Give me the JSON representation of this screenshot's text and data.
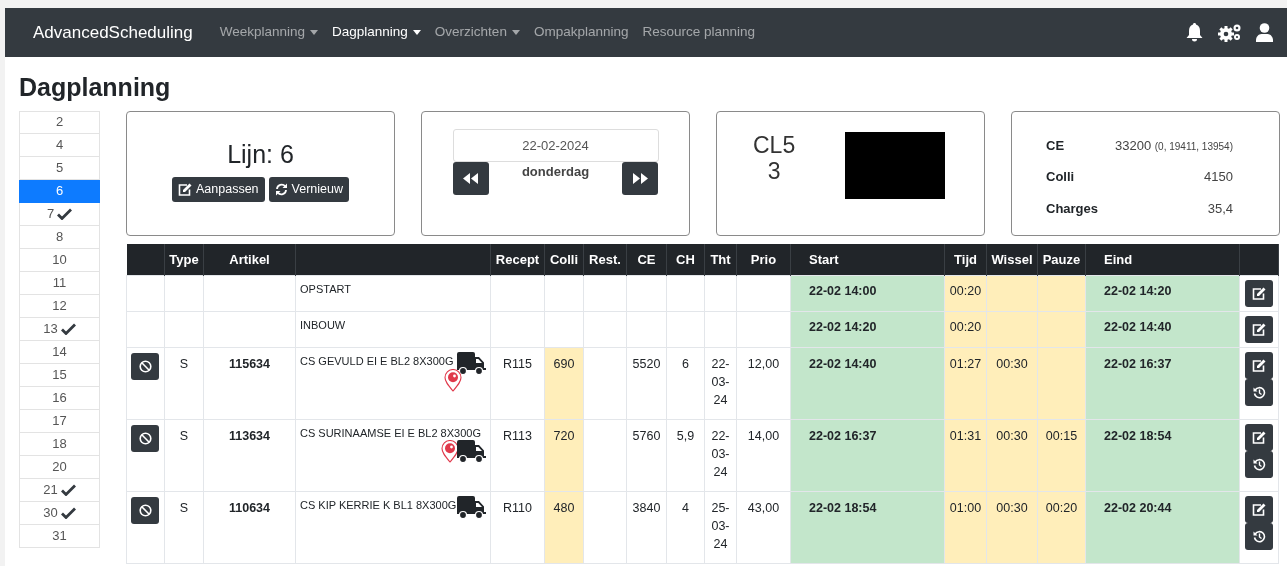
{
  "navbar": {
    "brand": "AdvancedScheduling",
    "items": [
      {
        "label": "Weekplanning",
        "dropdown": true,
        "selected": false
      },
      {
        "label": "Dagplanning",
        "dropdown": true,
        "selected": true
      },
      {
        "label": "Overzichten",
        "dropdown": true,
        "selected": false
      },
      {
        "label": "Ompakplanning",
        "dropdown": false,
        "selected": false
      },
      {
        "label": "Resource planning",
        "dropdown": false,
        "selected": false
      }
    ]
  },
  "page_title": "Dagplanning",
  "lines": [
    {
      "label": "2",
      "checked": false,
      "selected": false
    },
    {
      "label": "4",
      "checked": false,
      "selected": false
    },
    {
      "label": "5",
      "checked": false,
      "selected": false
    },
    {
      "label": "6",
      "checked": false,
      "selected": true
    },
    {
      "label": "7",
      "checked": true,
      "selected": false
    },
    {
      "label": "8",
      "checked": false,
      "selected": false
    },
    {
      "label": "10",
      "checked": false,
      "selected": false
    },
    {
      "label": "11",
      "checked": false,
      "selected": false
    },
    {
      "label": "12",
      "checked": false,
      "selected": false
    },
    {
      "label": "13",
      "checked": true,
      "selected": false
    },
    {
      "label": "14",
      "checked": false,
      "selected": false
    },
    {
      "label": "15",
      "checked": false,
      "selected": false
    },
    {
      "label": "16",
      "checked": false,
      "selected": false
    },
    {
      "label": "17",
      "checked": false,
      "selected": false
    },
    {
      "label": "18",
      "checked": false,
      "selected": false
    },
    {
      "label": "20",
      "checked": false,
      "selected": false
    },
    {
      "label": "21",
      "checked": true,
      "selected": false
    },
    {
      "label": "30",
      "checked": true,
      "selected": false
    },
    {
      "label": "31",
      "checked": false,
      "selected": false
    }
  ],
  "line_card": {
    "title": "Lijn: 6",
    "buttons": [
      {
        "label": "Aanpassen",
        "kind": "edit"
      },
      {
        "label": "Vernieuw",
        "kind": "refresh"
      }
    ]
  },
  "date_card": {
    "date": "22-02-2024",
    "weekday": "donderdag"
  },
  "code_card": {
    "lines": [
      "CL5",
      "3"
    ]
  },
  "totals": [
    {
      "label": "CE",
      "value": "33200",
      "detail": "(0, 19411, 13954)"
    },
    {
      "label": "Colli",
      "value": "4150"
    },
    {
      "label": "Charges",
      "value": "35,4"
    }
  ],
  "table": {
    "columns": [
      "",
      "Type",
      "Artikel",
      "",
      "Recept",
      "Colli",
      "Rest.",
      "CE",
      "CH",
      "Tht",
      "Prio",
      "Start",
      "Tijd",
      "Wissel",
      "Pauze",
      "Eind",
      ""
    ],
    "rows": [
      {
        "kind": "setup",
        "description": "OPSTART",
        "start": "22-02 14:00",
        "tijd": "00:20",
        "eind": "22-02 14:20"
      },
      {
        "kind": "setup",
        "description": "INBOUW",
        "start": "22-02 14:20",
        "tijd": "00:20",
        "eind": "22-02 14:40"
      },
      {
        "kind": "product",
        "type": "S",
        "artikel": "115634",
        "description": "CS GEVULD EI E BL2 8X300G",
        "marker": true,
        "marker_inline": false,
        "recept": "R115",
        "colli": "690",
        "ce": "5520",
        "ch": "6",
        "tht": "22-03-24",
        "prio": "12,00",
        "start": "22-02 14:40",
        "tijd": "01:27",
        "wissel": "00:30",
        "eind": "22-02 16:37"
      },
      {
        "kind": "product",
        "type": "S",
        "artikel": "113634",
        "description": "CS SURINAAMSE EI E BL2 8X300G",
        "marker": true,
        "marker_inline": true,
        "recept": "R113",
        "colli": "720",
        "ce": "5760",
        "ch": "5,9",
        "tht": "22-03-24",
        "prio": "14,00",
        "start": "22-02 16:37",
        "tijd": "01:31",
        "wissel": "00:30",
        "pauze": "00:15",
        "eind": "22-02 18:54"
      },
      {
        "kind": "product",
        "type": "S",
        "artikel": "110634",
        "description": "CS KIP KERRIE K BL1 8X300G",
        "marker": false,
        "recept": "R110",
        "colli": "480",
        "ce": "3840",
        "ch": "4",
        "tht": "25-03-24",
        "prio": "43,00",
        "start": "22-02 18:54",
        "tijd": "01:00",
        "wissel": "00:30",
        "pauze": "00:20",
        "eind": "22-02 20:44"
      }
    ]
  }
}
